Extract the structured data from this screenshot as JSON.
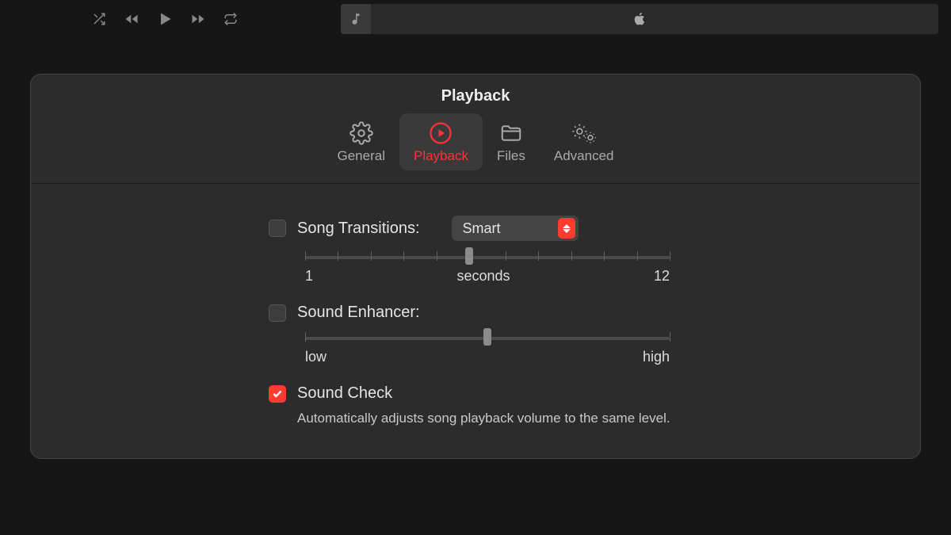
{
  "panel": {
    "title": "Playback",
    "tabs": [
      {
        "label": "General"
      },
      {
        "label": "Playback"
      },
      {
        "label": "Files"
      },
      {
        "label": "Advanced"
      }
    ]
  },
  "songTransitions": {
    "label": "Song Transitions:",
    "selected": "Smart",
    "slider": {
      "minLabel": "1",
      "centerLabel": "seconds",
      "maxLabel": "12"
    }
  },
  "soundEnhancer": {
    "label": "Sound Enhancer:",
    "slider": {
      "minLabel": "low",
      "maxLabel": "high"
    }
  },
  "soundCheck": {
    "label": "Sound Check",
    "description": "Automatically adjusts song playback volume to the same level."
  }
}
